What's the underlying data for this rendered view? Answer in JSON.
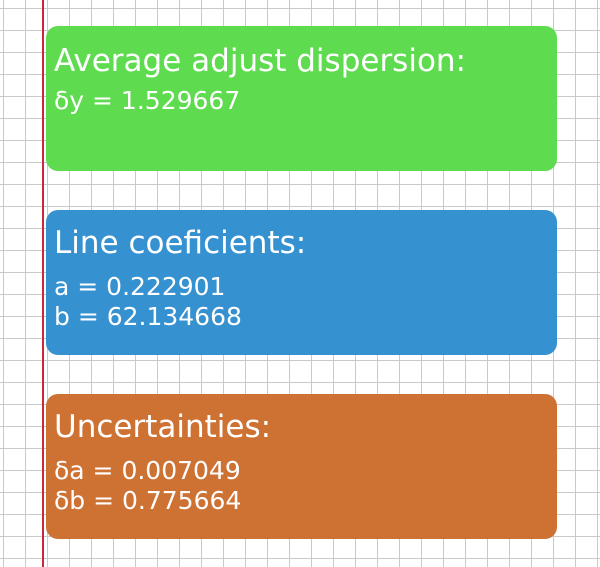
{
  "colors": {
    "dispersion_card": "#5fdb50",
    "coefficients_card": "#3591d0",
    "uncertainties_card": "#ce7234",
    "margin_line": "#c8283c",
    "grid_line": "#c9c9c9"
  },
  "dispersion": {
    "title": "Average adjust dispersion:",
    "dy": "δy = 1.529667"
  },
  "coefficients": {
    "title": "Line coeficients:",
    "a": "a = 0.222901",
    "b": "b = 62.134668"
  },
  "uncertainties": {
    "title": "Uncertainties:",
    "da": "δa = 0.007049",
    "db": "δb = 0.775664"
  }
}
